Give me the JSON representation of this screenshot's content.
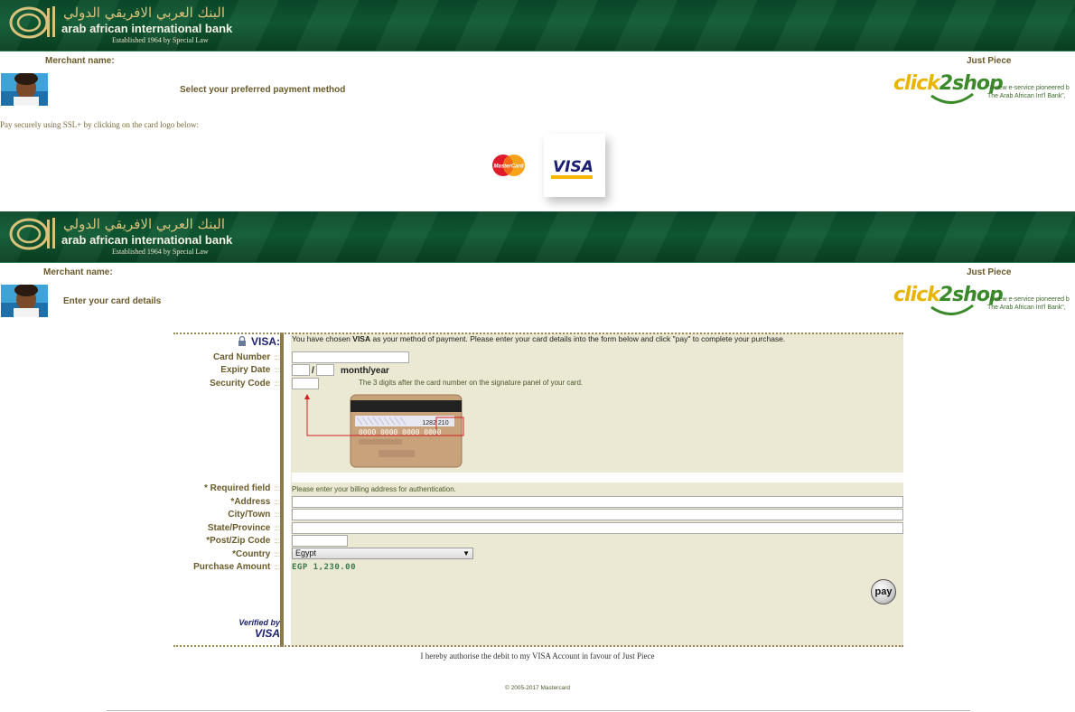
{
  "bank": {
    "name_arabic": "البنك العربي الافريقي الدولي",
    "name_english": "arab african international bank",
    "established": "Established 1964 by Special Law"
  },
  "merchant": {
    "label": "Merchant name:",
    "value": "Just Piece"
  },
  "click2shop": {
    "logo_text": "click2shop",
    "tagline_1": "\"A new e-service pioneered b",
    "tagline_2": "The Arab African Int'l Bank\","
  },
  "selection_section": {
    "heading": "Select your preferred payment method",
    "ssl_text": "Pay securely using SSL+ by clicking on the card logo below:",
    "mastercard_label": "MasterCard",
    "visa_label": "VISA"
  },
  "details_section": {
    "heading": "Enter your card details",
    "card_brand_label": "VISA:",
    "intro_prefix": "You have chosen ",
    "intro_brand": "VISA",
    "intro_suffix": " as your method of payment. Please enter your card details into the form below and click \"pay\" to complete your purchase.",
    "fields": {
      "card_number": "Card Number",
      "expiry_date": "Expiry Date",
      "security_code": "Security Code",
      "required_field": "* Required field",
      "address": "*Address",
      "city": "City/Town",
      "state": "State/Province",
      "postcode": "*Post/Zip Code",
      "country": "*Country",
      "purchase_amount": "Purchase Amount"
    },
    "separator": ":::",
    "expiry_slash": "/",
    "expiry_hint": "month/year",
    "security_note": "The 3 digits after the card number on the signature panel of your card.",
    "card_sample_number": "1282 210",
    "billing_note": "Please enter your billing address for authentication.",
    "country_value": "Egypt",
    "amount_value": "EGP 1,230.00",
    "pay_label": "pay",
    "verified_by": "Verified by",
    "verified_brand": "VISA"
  },
  "footer": {
    "authorise": "I hereby authorise the debit to my VISA Account in favour of Just Piece",
    "copyright": "© 2005-2017 Mastercard"
  },
  "colors": {
    "banner_green": "#0f5a34",
    "label_brown": "#6b5a2a",
    "panel_beige": "#ebe8d3",
    "visa_blue": "#1a1f71",
    "amount_green": "#3a7a4a"
  }
}
